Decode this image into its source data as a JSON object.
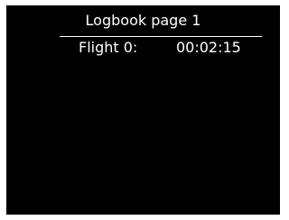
{
  "page": {
    "title": "Logbook page 1"
  },
  "entries": [
    {
      "label": "Flight 0:",
      "duration": "00:02:15"
    }
  ],
  "colors": {
    "background": "#000000",
    "text": "#ffffff",
    "frame": "#ffffff"
  }
}
